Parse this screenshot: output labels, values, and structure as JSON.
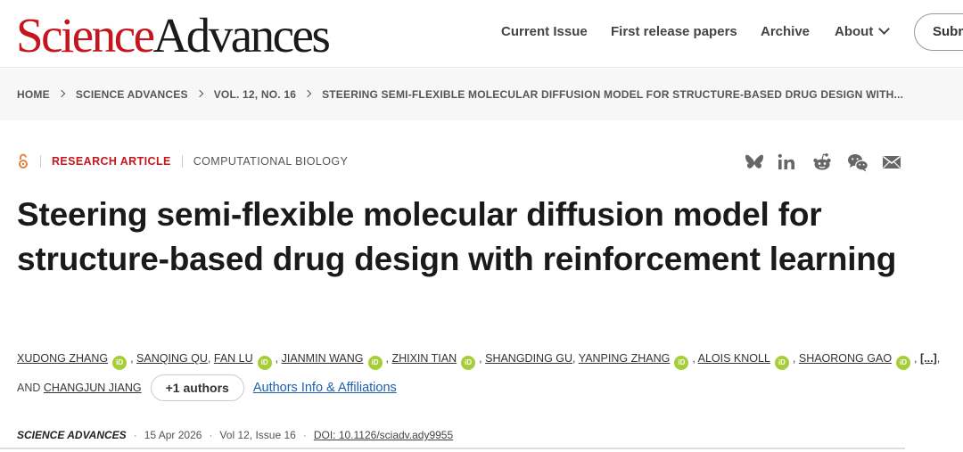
{
  "header": {
    "logo": {
      "science": "Science",
      "advances": "Advances"
    },
    "nav": [
      {
        "label": "Current Issue"
      },
      {
        "label": "First release papers"
      },
      {
        "label": "Archive"
      },
      {
        "label": "About"
      }
    ],
    "submit_label": "Submit manuscript"
  },
  "breadcrumb": [
    "HOME",
    "SCIENCE ADVANCES",
    "VOL. 12, NO. 16",
    "STEERING SEMI-FLEXIBLE MOLECULAR DIFFUSION MODEL FOR STRUCTURE-BASED DRUG DESIGN WITH..."
  ],
  "article": {
    "access_icon": "open-access-icon",
    "type": "RESEARCH ARTICLE",
    "subject": "COMPUTATIONAL BIOLOGY",
    "share_icons": [
      "bluesky-icon",
      "linkedin-icon",
      "reddit-icon",
      "wechat-icon",
      "email-icon"
    ],
    "title": "Steering semi-flexible molecular diffusion model for structure-based drug design with reinforcement learning",
    "authors": [
      {
        "name": "XUDONG ZHANG",
        "orcid": true
      },
      {
        "name": "SANQING QU",
        "orcid": false
      },
      {
        "name": "FAN LU",
        "orcid": true
      },
      {
        "name": "JIANMIN WANG",
        "orcid": true
      },
      {
        "name": "ZHIXIN TIAN",
        "orcid": true
      },
      {
        "name": "SHANGDING GU",
        "orcid": false
      },
      {
        "name": "YANPING ZHANG",
        "orcid": true
      },
      {
        "name": "ALOIS KNOLL",
        "orcid": true
      },
      {
        "name": "SHAORONG GAO",
        "orcid": true
      }
    ],
    "orcid_badge": "iD",
    "authors_ellipsis": "[...]",
    "and_text": "AND",
    "last_author": "CHANGJUN JIANG",
    "more_authors_label": "+1 authors",
    "affiliations_link": "Authors Info & Affiliations",
    "journal": "SCIENCE ADVANCES",
    "date": "15 Apr 2026",
    "volume_issue": "Vol 12, Issue 16",
    "doi": "DOI: 10.1126/sciadv.ady9955"
  },
  "colors": {
    "brand_red": "#c4161c",
    "orcid_green": "#a6ce39",
    "link_blue": "#1a5fb4"
  }
}
